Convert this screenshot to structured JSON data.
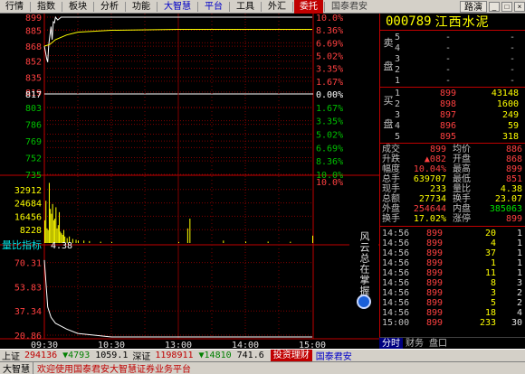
{
  "menu": {
    "items": [
      {
        "label": "行情",
        "style": ""
      },
      {
        "label": "指数",
        "style": ""
      },
      {
        "label": "板块",
        "style": ""
      },
      {
        "label": "分析",
        "style": ""
      },
      {
        "label": "功能",
        "style": ""
      },
      {
        "label": "大智慧",
        "style": "blue"
      },
      {
        "label": "平台",
        "style": "blue"
      },
      {
        "label": "工具",
        "style": ""
      },
      {
        "label": "外汇",
        "style": ""
      },
      {
        "label": "委托",
        "style": "hl"
      },
      {
        "label": "国泰君安",
        "style": "gray"
      }
    ],
    "speed_button": "路演"
  },
  "stock": {
    "code": "000789",
    "name": "江西水泥"
  },
  "order_book": {
    "sell_label": [
      "卖",
      "盘"
    ],
    "buy_label": [
      "买",
      "盘"
    ],
    "sell": [
      {
        "idx": "5",
        "price": "-",
        "vol": "-"
      },
      {
        "idx": "4",
        "price": "-",
        "vol": "-"
      },
      {
        "idx": "3",
        "price": "-",
        "vol": "-"
      },
      {
        "idx": "2",
        "price": "-",
        "vol": "-"
      },
      {
        "idx": "1",
        "price": "-",
        "vol": "-"
      }
    ],
    "buy": [
      {
        "idx": "1",
        "price": "899",
        "vol": "43148"
      },
      {
        "idx": "2",
        "price": "898",
        "vol": "1600"
      },
      {
        "idx": "3",
        "price": "897",
        "vol": "249"
      },
      {
        "idx": "4",
        "price": "896",
        "vol": "59"
      },
      {
        "idx": "5",
        "price": "895",
        "vol": "318"
      }
    ]
  },
  "stats": [
    {
      "l1": "成交",
      "v1": "899",
      "c1": "red",
      "l2": "均价",
      "v2": "886",
      "c2": "red"
    },
    {
      "l1": "升跌",
      "v1": "▲082",
      "c1": "red",
      "l2": "开盘",
      "v2": "868",
      "c2": "red"
    },
    {
      "l1": "幅度",
      "v1": "10.04%",
      "c1": "red",
      "l2": "最高",
      "v2": "899",
      "c2": "red"
    },
    {
      "l1": "总手",
      "v1": "639707",
      "c1": "yel",
      "l2": "最低",
      "v2": "851",
      "c2": "red"
    },
    {
      "l1": "现手",
      "v1": "233",
      "c1": "yel",
      "l2": "量比",
      "v2": "4.38",
      "c2": "yel"
    },
    {
      "l1": "总额",
      "v1": "27734",
      "c1": "yel",
      "l2": "换手",
      "v2": "23.07",
      "c2": "yel"
    },
    {
      "l1": "外盘",
      "v1": "254644",
      "c1": "red",
      "l2": "内盘",
      "v2": "385063",
      "c2": "grn"
    },
    {
      "l1": "换手",
      "v1": "17.02%",
      "c1": "yel",
      "l2": "涨停",
      "v2": "899",
      "c2": "red"
    }
  ],
  "ticks": [
    {
      "t": "14:56",
      "p": "899",
      "v": "20",
      "n": "1"
    },
    {
      "t": "14:56",
      "p": "899",
      "v": "4",
      "n": "1"
    },
    {
      "t": "14:56",
      "p": "899",
      "v": "37",
      "n": "1"
    },
    {
      "t": "14:56",
      "p": "899",
      "v": "1",
      "n": "1"
    },
    {
      "t": "14:56",
      "p": "899",
      "v": "11",
      "n": "1"
    },
    {
      "t": "14:56",
      "p": "899",
      "v": "8",
      "n": "3"
    },
    {
      "t": "14:56",
      "p": "899",
      "v": "3",
      "n": "2"
    },
    {
      "t": "14:56",
      "p": "899",
      "v": "5",
      "n": "2"
    },
    {
      "t": "14:56",
      "p": "899",
      "v": "18",
      "n": "4"
    },
    {
      "t": "15:00",
      "p": "899",
      "v": "233",
      "n": "30"
    }
  ],
  "rp_tabs": [
    "分时",
    "财务",
    "盘口"
  ],
  "side_banner": "风云总在掌握",
  "status": {
    "sh_label": "上证",
    "sh_val": "294136",
    "sh_chg": "▼4793",
    "sh_amt": "1059.1",
    "sz_label": "深证",
    "sz_val": "1198911",
    "sz_chg": "▼14810",
    "sz_amt": "741.6",
    "promo": "投资理财",
    "broker": "国泰君安"
  },
  "marquee": {
    "app": "大智慧",
    "msg": "欢迎使用国泰君安大智慧证券业务平台"
  },
  "colors": {
    "price_line": "#ffffff",
    "avg_line": "#ffff00",
    "grid": "#800000",
    "volume": "#ffff00",
    "ratio_line": "#ffffff",
    "up_text": "#ff4040",
    "down_text": "#00c000"
  },
  "chart_data": [
    {
      "type": "line",
      "name": "price",
      "prev_close": 817,
      "ylim": [
        735,
        899
      ],
      "y_ticks": [
        "899",
        "885",
        "868",
        "852",
        "835",
        "819",
        "817",
        "803",
        "786",
        "769",
        "752",
        "735"
      ],
      "pct_ticks": [
        "10.0%",
        "8.36%",
        "6.69%",
        "5.02%",
        "3.35%",
        "1.67%",
        "0.00%",
        "1.67%",
        "3.35%",
        "5.02%",
        "6.69%",
        "8.36%",
        "10.0%"
      ],
      "x_ticks": [
        "09:30",
        "10:30",
        "13:00",
        "14:00",
        "15:00"
      ],
      "x_minutes": [
        0,
        60,
        120,
        180,
        240
      ],
      "series": [
        {
          "values_minutes": [
            0,
            1,
            2,
            3,
            4,
            5,
            6,
            7,
            8,
            9,
            10,
            12,
            15,
            20,
            30,
            45,
            60,
            90,
            120,
            180,
            240
          ],
          "price": [
            868,
            862,
            855,
            851,
            870,
            880,
            889,
            875,
            894,
            893,
            899,
            896,
            899,
            899,
            899,
            899,
            899,
            899,
            899,
            899,
            899
          ]
        },
        {
          "values_minutes": [
            0,
            5,
            10,
            20,
            30,
            60,
            120,
            180,
            240
          ],
          "avg": [
            868,
            870,
            875,
            880,
            883,
            885,
            886,
            886,
            886
          ]
        }
      ]
    },
    {
      "type": "bar",
      "name": "volume",
      "y_ticks": [
        "32912",
        "24684",
        "16456",
        "8228"
      ],
      "ylim": [
        0,
        41140
      ],
      "minutes": [
        0,
        1,
        2,
        3,
        4,
        5,
        6,
        7,
        8,
        9,
        10,
        11,
        12,
        13,
        14,
        15,
        16,
        17,
        18,
        20,
        22,
        25,
        28,
        30,
        35,
        40,
        50,
        60,
        120,
        128,
        130,
        160,
        180,
        200,
        220,
        240
      ],
      "values": [
        14000,
        26000,
        9000,
        8000,
        37000,
        21000,
        18000,
        24000,
        14000,
        15000,
        22000,
        9000,
        11000,
        19000,
        7000,
        6000,
        5000,
        8000,
        4000,
        3000,
        4000,
        2500,
        2000,
        1500,
        1500,
        1200,
        800,
        600,
        600,
        9000,
        15000,
        1500,
        900,
        900,
        800,
        4500
      ]
    },
    {
      "type": "line",
      "name": "volume_ratio",
      "title": "量比指标",
      "current": "4.38",
      "ylim": [
        20.86,
        75
      ],
      "y_ticks": [
        "70.31",
        "53.83",
        "37.34",
        "20.86"
      ],
      "minutes": [
        0,
        3,
        6,
        10,
        20,
        30,
        60,
        90,
        120,
        150,
        180,
        210,
        240
      ],
      "values": [
        72,
        40,
        33,
        29,
        25,
        22,
        17,
        14,
        11,
        9,
        7.5,
        6,
        4.38
      ]
    }
  ]
}
